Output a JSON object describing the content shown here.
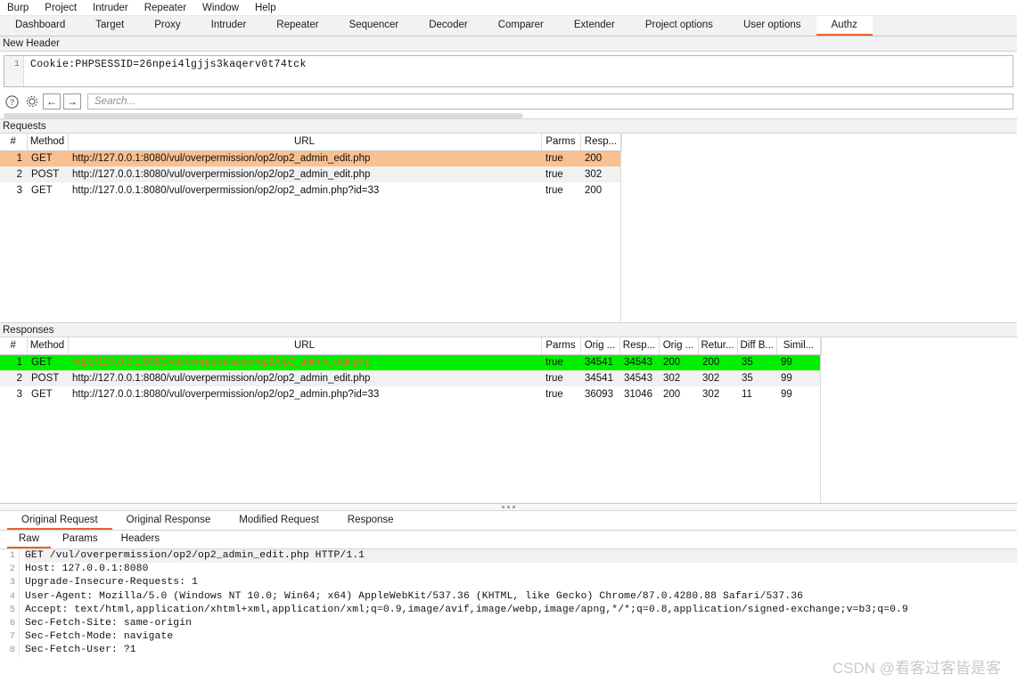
{
  "colors": {
    "accent": "#e8622c",
    "selected_request_row": "#fac08f",
    "selected_response_row": "#00f000",
    "url_text": "#e8622c",
    "panel_bg": "#f2f2f2"
  },
  "menubar": {
    "items": [
      {
        "label": "Burp"
      },
      {
        "label": "Project"
      },
      {
        "label": "Intruder"
      },
      {
        "label": "Repeater"
      },
      {
        "label": "Window"
      },
      {
        "label": "Help"
      }
    ]
  },
  "main_tabs": {
    "active": "Authz",
    "items": [
      {
        "label": "Dashboard"
      },
      {
        "label": "Target"
      },
      {
        "label": "Proxy"
      },
      {
        "label": "Intruder"
      },
      {
        "label": "Repeater"
      },
      {
        "label": "Sequencer"
      },
      {
        "label": "Decoder"
      },
      {
        "label": "Comparer"
      },
      {
        "label": "Extender"
      },
      {
        "label": "Project options"
      },
      {
        "label": "User options"
      },
      {
        "label": "Authz"
      }
    ]
  },
  "new_header": {
    "label": "New Header",
    "line_number": "1",
    "value": "Cookie:PHPSESSID=26npei4lgjjs3kaqerv0t74tck"
  },
  "toolbar": {
    "help_icon": "help-circle-icon",
    "settings_icon": "gear-icon",
    "back_label": "←",
    "forward_label": "→",
    "search_placeholder": "Search..."
  },
  "requests": {
    "title": "Requests",
    "columns": [
      "#",
      "Method",
      "URL",
      "Parms",
      "Resp..."
    ],
    "rows": [
      {
        "num": "1",
        "method": "GET",
        "url": "http://127.0.0.1:8080/vul/overpermission/op2/op2_admin_edit.php",
        "parms": "true",
        "resp": "200",
        "selected": true
      },
      {
        "num": "2",
        "method": "POST",
        "url": "http://127.0.0.1:8080/vul/overpermission/op2/op2_admin_edit.php",
        "parms": "true",
        "resp": "302",
        "selected": false
      },
      {
        "num": "3",
        "method": "GET",
        "url": "http://127.0.0.1:8080/vul/overpermission/op2/op2_admin.php?id=33",
        "parms": "true",
        "resp": "200",
        "selected": false
      }
    ]
  },
  "responses": {
    "title": "Responses",
    "columns": [
      "#",
      "Method",
      "URL",
      "Parms",
      "Orig ...",
      "Resp...",
      "Orig ...",
      "Retur...",
      "Diff B...",
      "Simil..."
    ],
    "rows": [
      {
        "num": "1",
        "method": "GET",
        "url": "http://127.0.0.1:8080/vul/overpermission/op2/op2_admin_edit.php",
        "parms": "true",
        "orig_len": "34541",
        "resp_len": "34543",
        "orig_status": "200",
        "return_status": "200",
        "diff_bytes": "35",
        "similarity": "99",
        "selected": true
      },
      {
        "num": "2",
        "method": "POST",
        "url": "http://127.0.0.1:8080/vul/overpermission/op2/op2_admin_edit.php",
        "parms": "true",
        "orig_len": "34541",
        "resp_len": "34543",
        "orig_status": "302",
        "return_status": "302",
        "diff_bytes": "35",
        "similarity": "99",
        "selected": false
      },
      {
        "num": "3",
        "method": "GET",
        "url": "http://127.0.0.1:8080/vul/overpermission/op2/op2_admin.php?id=33",
        "parms": "true",
        "orig_len": "36093",
        "resp_len": "31046",
        "orig_status": "200",
        "return_status": "302",
        "diff_bytes": "11",
        "similarity": "99",
        "selected": false
      }
    ]
  },
  "detail_tabs": {
    "active": "Original Request",
    "items": [
      {
        "label": "Original Request"
      },
      {
        "label": "Original Response"
      },
      {
        "label": "Modified Request"
      },
      {
        "label": "Response"
      }
    ]
  },
  "view_tabs": {
    "active": "Raw",
    "items": [
      {
        "label": "Raw"
      },
      {
        "label": "Params"
      },
      {
        "label": "Headers"
      }
    ]
  },
  "raw_request": {
    "lines": [
      {
        "n": "1",
        "text": "GET /vul/overpermission/op2/op2_admin_edit.php HTTP/1.1"
      },
      {
        "n": "2",
        "text": "Host: 127.0.0.1:8080"
      },
      {
        "n": "3",
        "text": "Upgrade-Insecure-Requests: 1"
      },
      {
        "n": "4",
        "text": "User-Agent: Mozilla/5.0 (Windows NT 10.0; Win64; x64) AppleWebKit/537.36 (KHTML, like Gecko) Chrome/87.0.4280.88 Safari/537.36"
      },
      {
        "n": "5",
        "text": "Accept: text/html,application/xhtml+xml,application/xml;q=0.9,image/avif,image/webp,image/apng,*/*;q=0.8,application/signed-exchange;v=b3;q=0.9"
      },
      {
        "n": "6",
        "text": "Sec-Fetch-Site: same-origin"
      },
      {
        "n": "7",
        "text": "Sec-Fetch-Mode: navigate"
      },
      {
        "n": "8",
        "text": "Sec-Fetch-User: ?1"
      }
    ]
  },
  "watermark": {
    "text": "CSDN @看客过客皆是客"
  }
}
